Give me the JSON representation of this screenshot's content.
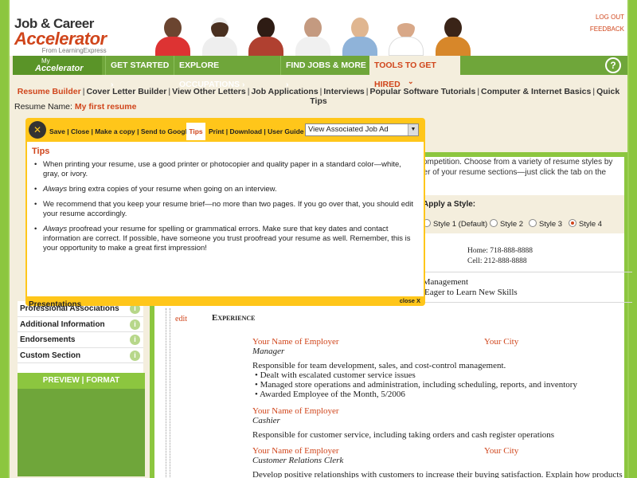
{
  "header": {
    "logo_line1": "Job & Career",
    "logo_line2": "Accelerator",
    "logo_line3": "From LearningExpress",
    "log_out": "LOG OUT",
    "feedback": "FEEDBACK"
  },
  "nav": {
    "my_small": "My",
    "my_big": "Accelerator",
    "items": [
      "GET STARTED",
      "EXPLORE OCCUPATIONS",
      "FIND JOBS & MORE",
      "TOOLS TO GET HIRED"
    ],
    "help": "?"
  },
  "subnav": [
    "Resume Builder",
    "Cover Letter Builder",
    "View Other Letters",
    "Job Applications",
    "Interviews",
    "Popular Software Tutorials",
    "Computer & Internet Basics",
    "Quick Tips"
  ],
  "resume_name": {
    "label": "Resume Name:",
    "value": "My first resume"
  },
  "toolbar": {
    "left": "Save | Close | Make a copy | Send to Google",
    "tips": "Tips",
    "right": "Print | Download | User Guide",
    "select_value": "View Associated Job Ad"
  },
  "tips_panel": {
    "title": "Tips",
    "items": [
      {
        "pre": "",
        "em": "",
        "text": "When printing your resume, use a good printer or photocopier and quality paper in a standard color—white, gray, or ivory."
      },
      {
        "pre": "",
        "em": "Always",
        "text": " bring extra copies of your resume when going on an interview."
      },
      {
        "pre": "",
        "em": "",
        "text": "We recommend that you keep your resume brief—no more than two pages. If you go over that, you should edit your resume accordingly."
      },
      {
        "pre": "",
        "em": "Always",
        "text": " proofread your resume for spelling or grammatical errors. Make sure that key dates and contact information are correct. If possible, have someone you trust proofread your resume as well. Remember, this is your opportunity to make a great first impression!"
      }
    ],
    "close": "close X"
  },
  "intro_text": "competition. Choose from a variety of resume styles by\nder of your resume sections—just click the tab on the",
  "apply_style": {
    "label": "Apply a Style:",
    "options": [
      "Style 1 (Default)",
      "Style 2",
      "Style 3",
      "Style 4"
    ],
    "selected": "Style 4"
  },
  "left_sections": {
    "partial": "Presentations",
    "items": [
      "Professional Associations",
      "Additional Information",
      "Endorsements",
      "Custom Section"
    ],
    "info_icon": "i",
    "preview_format": "PREVIEW | FORMAT"
  },
  "resume": {
    "home": "Home: 718-888-8888",
    "cell": "Cell: 212-888-8888",
    "skills1": "el Management",
    "skills2": "r • Eager to Learn New Skills",
    "edit": "edit",
    "section": "Experience",
    "jobs": [
      {
        "employer": "Your Name of Employer",
        "city": "Your City",
        "title": "Manager",
        "desc": "Responsible for team development, sales, and cost-control management.",
        "bullets": [
          "Dealt with escalated customer service issues",
          "Managed store operations and administration, including scheduling, reports, and inventory",
          "Awarded Employee of the Month, 5/2006"
        ]
      },
      {
        "employer": "Your Name of Employer",
        "city": "",
        "title": "Cashier",
        "desc": "Responsible for customer service, including taking orders and cash register operations"
      },
      {
        "employer": "Your Name of Employer",
        "city": "Your City",
        "title": "Customer Relations Clerk",
        "desc": "Develop positive relationships with customers to increase their buying satisfaction. Explain how products"
      }
    ]
  },
  "colors": {
    "brand_green": "#8cc63f",
    "accent_orange": "#d0451b",
    "toolbar_yellow": "#ffc61a"
  }
}
